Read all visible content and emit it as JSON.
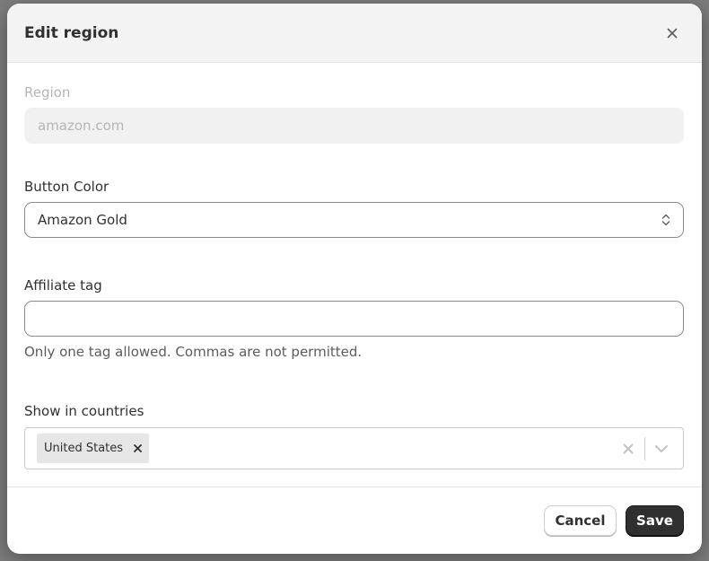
{
  "modal": {
    "title": "Edit region"
  },
  "fields": {
    "region": {
      "label": "Region",
      "value": "amazon.com"
    },
    "button_color": {
      "label": "Button Color",
      "selected": "Amazon Gold"
    },
    "affiliate_tag": {
      "label": "Affiliate tag",
      "value": "",
      "help": "Only one tag allowed. Commas are not permitted."
    },
    "countries": {
      "label": "Show in countries",
      "selected": [
        "United States"
      ]
    }
  },
  "footer": {
    "cancel_label": "Cancel",
    "save_label": "Save"
  },
  "colors": {
    "primary_button": "#303030",
    "header_bg": "#f3f3f3",
    "disabled_text": "#b5b5b5"
  }
}
